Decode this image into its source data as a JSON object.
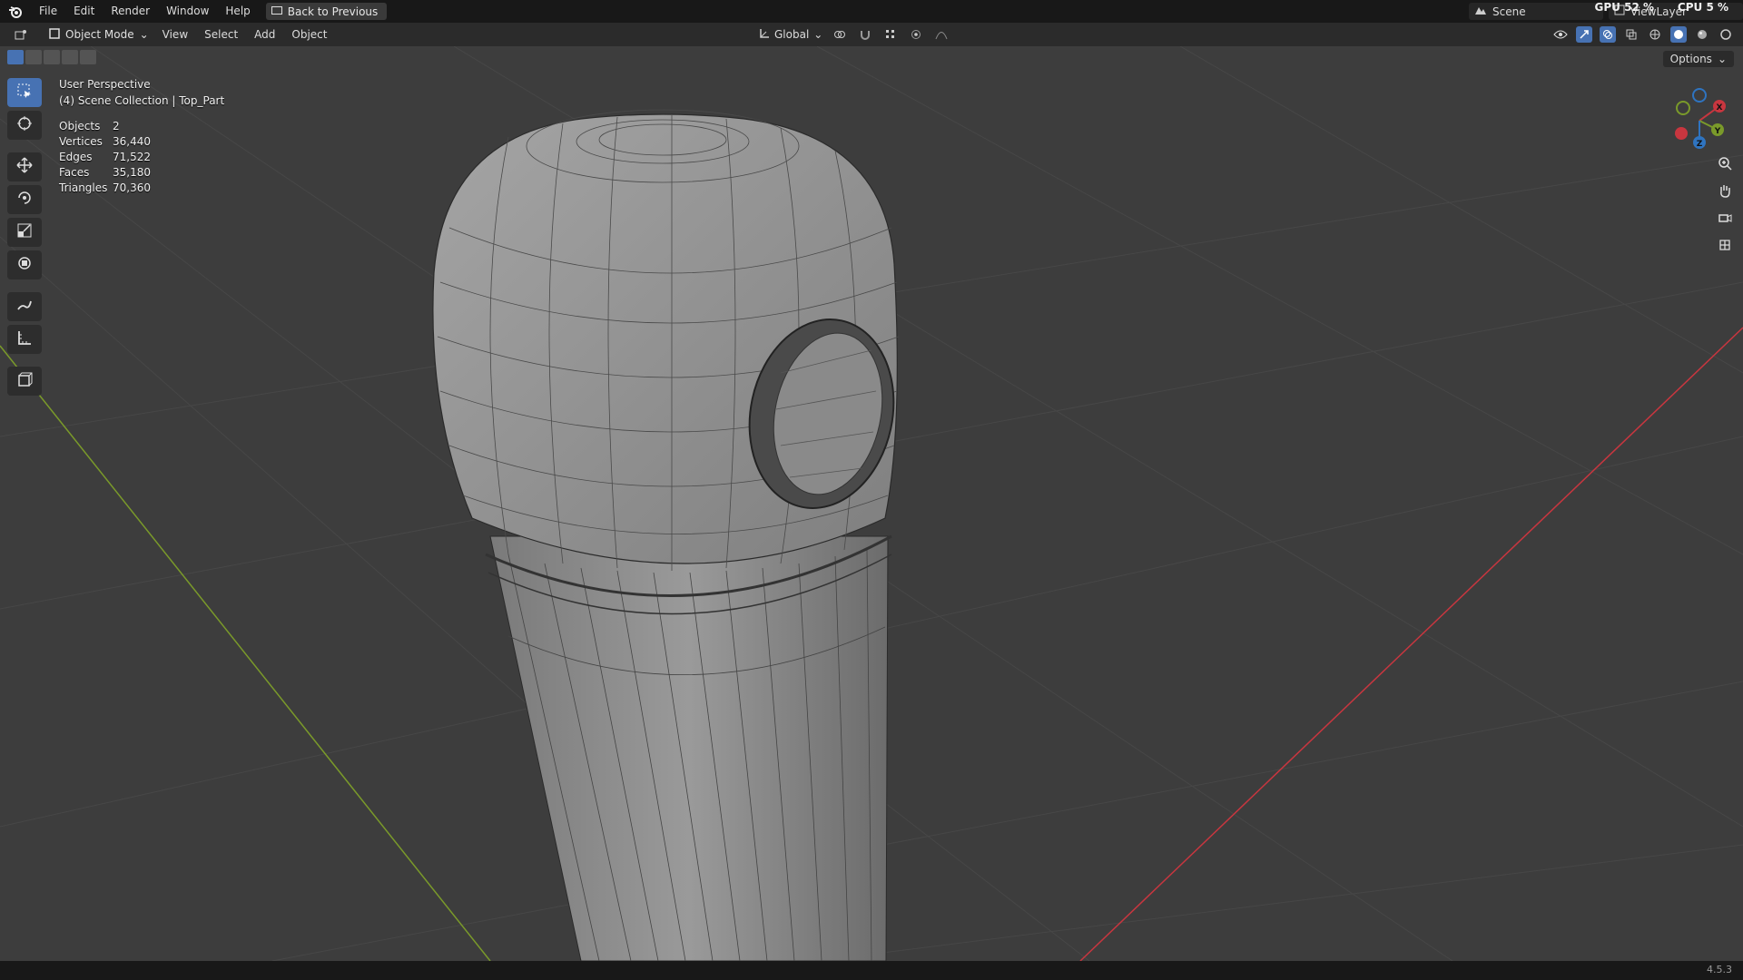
{
  "topbar": {
    "menus": [
      "File",
      "Edit",
      "Render",
      "Window",
      "Help"
    ],
    "back_label": "Back to Previous",
    "scene": "Scene",
    "view_layer": "ViewLayer",
    "gpu": "GPU 52 %",
    "cpu": "CPU 5 %"
  },
  "header": {
    "mode": "Object Mode",
    "menus": [
      "View",
      "Select",
      "Add",
      "Object"
    ],
    "transform_orientation": "Global"
  },
  "viewport": {
    "perspective": "User Perspective",
    "collection": "(4) Scene Collection | Top_Part",
    "options_label": "Options",
    "stats": [
      {
        "label": "Objects",
        "value": "2"
      },
      {
        "label": "Vertices",
        "value": "36,440"
      },
      {
        "label": "Edges",
        "value": "71,522"
      },
      {
        "label": "Faces",
        "value": "35,180"
      },
      {
        "label": "Triangles",
        "value": "70,360"
      }
    ],
    "gizmo": {
      "x": "X",
      "y": "Y",
      "z": "Z"
    }
  },
  "toolbar": {
    "tools": [
      "select-box-icon",
      "cursor-icon",
      "move-icon",
      "rotate-icon",
      "scale-icon",
      "transform-icon",
      "annotate-icon",
      "measure-icon",
      "add-cube-icon"
    ]
  },
  "status": {
    "version": "4.5.3"
  },
  "colors": {
    "accent": "#4772b3",
    "x_axis": "#c8363f",
    "y_axis": "#7a9a2a",
    "z_axis": "#2f74c0"
  }
}
